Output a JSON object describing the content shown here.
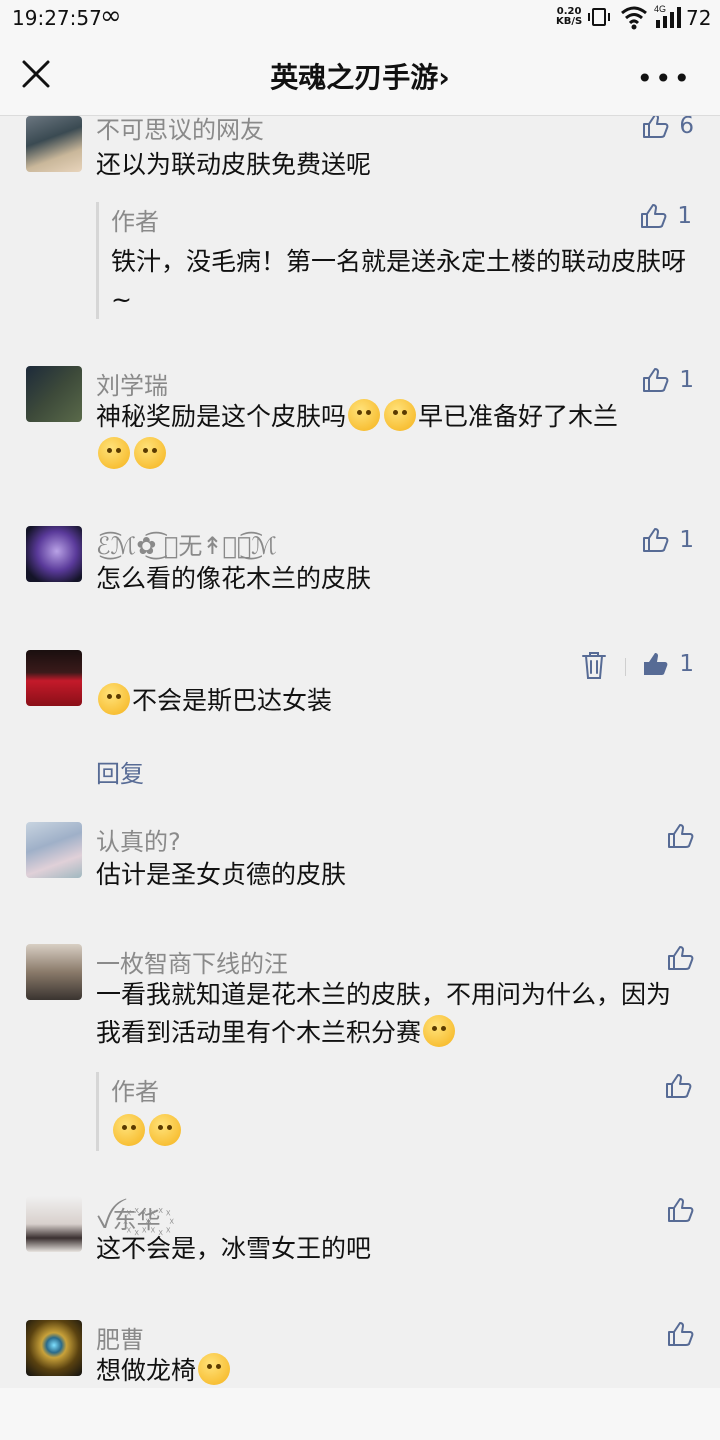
{
  "status": {
    "time": "19:27:57",
    "infinity": "∞",
    "netspeed_top": "0.20",
    "netspeed_bottom": "KB/S",
    "network": "4G",
    "battery": "72"
  },
  "nav": {
    "title": "英魂之刃手游",
    "title_arrow": "›",
    "more": "•••"
  },
  "comments": [
    {
      "name": "不可思议的网友",
      "text": "还以为联动皮肤免费送呢",
      "likes": "6",
      "reply": {
        "name": "作者",
        "text": "铁汁，没毛病！第一名就是送永定土楼的联动皮肤呀~",
        "likes": "1"
      }
    },
    {
      "name": "刘学瑞",
      "text_a": "神秘奖励是这个皮肤吗",
      "text_b": "早已准备好了木兰",
      "likes": "1"
    },
    {
      "name": "ℰ͜͡ℳ✿͜͡ ⃢无↟念⃢͜͡ℳ",
      "text": "怎么看的像花木兰的皮肤",
      "likes": "1"
    },
    {
      "name": "",
      "text": "不会是斯巴达女装",
      "likes": "1",
      "reply_label": "回复"
    },
    {
      "name": "认真的?",
      "text": "估计是圣女贞德的皮肤"
    },
    {
      "name": "一枚智商下线的汪",
      "text": "一看我就知道是花木兰的皮肤，不用问为什么，因为我看到活动里有个木兰积分赛",
      "reply": {
        "name": "作者"
      }
    },
    {
      "name": "ꪜ东꙰华꙰",
      "text": "这不会是，冰雪女王的吧"
    },
    {
      "name": "肥曹",
      "text": "想做龙椅"
    }
  ],
  "colors": {
    "accent": "#576b95",
    "name_gray": "#8a8a8a",
    "bg": "#f0f0f0"
  }
}
